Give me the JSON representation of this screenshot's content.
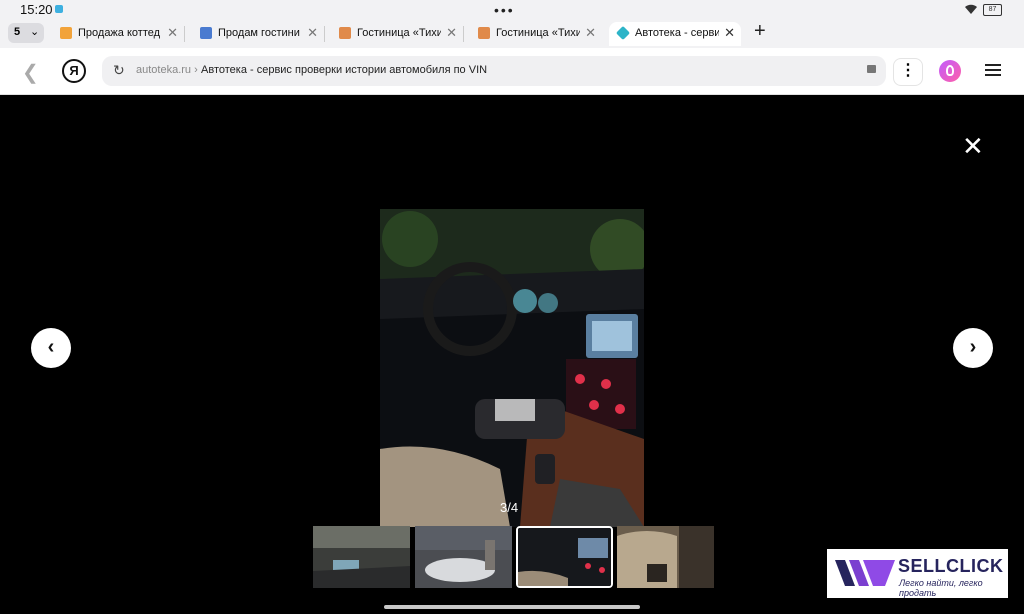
{
  "status": {
    "time": "15:20",
    "battery": "87"
  },
  "tabs": {
    "count": "5",
    "items": [
      {
        "label": "Продажа коттед",
        "favicon_color": "#f2a33a",
        "active": false
      },
      {
        "label": "Продам гостини",
        "favicon_color": "#4a7bd0",
        "active": false
      },
      {
        "label": "Гостиница «Тихи",
        "favicon_color": "#e08a4a",
        "active": false
      },
      {
        "label": "Гостиница «Тихи",
        "favicon_color": "#e08a4a",
        "active": false
      },
      {
        "label": "Автотека - серви",
        "favicon_color": "#2db4c8",
        "active": true
      }
    ],
    "close_glyph": "✕",
    "new_tab_glyph": "+"
  },
  "address": {
    "logo": "Я",
    "domain": "autoteka.ru",
    "separator": "›",
    "page_title": "Автотека - сервис проверки истории автомобиля по VIN"
  },
  "viewer": {
    "counter": "3/4",
    "close_glyph": "✕",
    "prev_glyph": "‹",
    "next_glyph": "›",
    "current_index": 3,
    "total": 4
  },
  "watermark": {
    "brand": "SELLCLICK",
    "tagline": "Легко найти, легко продать",
    "color": "#26245d"
  },
  "icons": [
    "back-arrow-icon",
    "reload-icon",
    "lock-icon",
    "more-dots-icon",
    "alice-icon",
    "menu-icon",
    "close-icon",
    "chevron-left-icon",
    "chevron-right-icon",
    "wifi-icon",
    "battery-icon"
  ]
}
